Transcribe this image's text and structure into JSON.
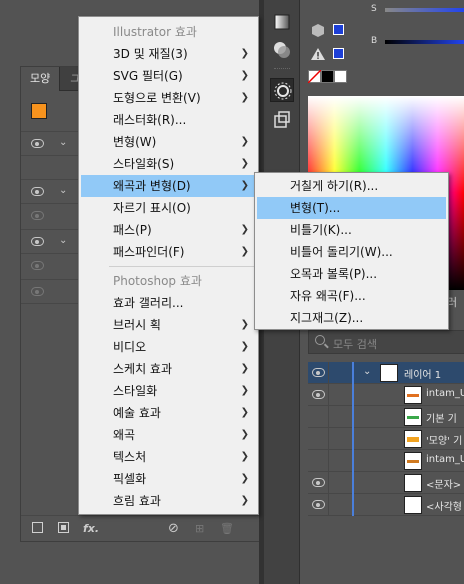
{
  "appearance_panel": {
    "tabs": [
      "모양",
      "ユ"
    ],
    "swatch_color": "#f7931e"
  },
  "main_menu": {
    "items": [
      {
        "label": "Illustrator 효과",
        "type": "header"
      },
      {
        "label": "3D 및 재질(3)",
        "submenu": true
      },
      {
        "label": "SVG 필터(G)",
        "submenu": true
      },
      {
        "label": "도형으로 변환(V)",
        "submenu": true
      },
      {
        "label": "래스터화(R)...",
        "submenu": false
      },
      {
        "label": "변형(W)",
        "submenu": true
      },
      {
        "label": "스타일화(S)",
        "submenu": true
      },
      {
        "label": "왜곡과 변형(D)",
        "submenu": true,
        "highlighted": true
      },
      {
        "label": "자르기 표시(O)",
        "submenu": false
      },
      {
        "label": "패스(P)",
        "submenu": true
      },
      {
        "label": "패스파인더(F)",
        "submenu": true
      },
      {
        "label": "Photoshop 효과",
        "type": "header"
      },
      {
        "label": "효과 갤러리...",
        "submenu": false
      },
      {
        "label": "브러시 획",
        "submenu": true
      },
      {
        "label": "비디오",
        "submenu": true
      },
      {
        "label": "스케치 효과",
        "submenu": true
      },
      {
        "label": "스타일화",
        "submenu": true
      },
      {
        "label": "예술 효과",
        "submenu": true
      },
      {
        "label": "왜곡",
        "submenu": true
      },
      {
        "label": "텍스처",
        "submenu": true
      },
      {
        "label": "픽셀화",
        "submenu": true
      },
      {
        "label": "흐림 효과",
        "submenu": true
      }
    ]
  },
  "sub_menu": {
    "items": [
      {
        "label": "거칠게 하기(R)..."
      },
      {
        "label": "변형(T)...",
        "highlighted": true
      },
      {
        "label": "비틀기(K)..."
      },
      {
        "label": "비틀어 돌리기(W)..."
      },
      {
        "label": "오목과 볼록(P)..."
      },
      {
        "label": "자유 왜곡(F)..."
      },
      {
        "label": "지그재그(Z)..."
      }
    ]
  },
  "color_panel": {
    "slider_s": "S",
    "slider_b": "B",
    "colors": {
      "blue_chip": "#1d3fd6",
      "black": "#000000",
      "white": "#ffffff"
    }
  },
  "layers_panel": {
    "tab_label": "러",
    "search_placeholder": "모두 검색",
    "layers": [
      {
        "name": "레이어 1",
        "visible": true,
        "top": true
      },
      {
        "name": "intam_U",
        "visible": true
      },
      {
        "name": "기본 기",
        "visible": false
      },
      {
        "name": "'모양' 기",
        "visible": false
      },
      {
        "name": "intam_U",
        "visible": false
      },
      {
        "name": "<문자>",
        "visible": true
      },
      {
        "name": "<사각형",
        "visible": true
      }
    ]
  },
  "icons": {
    "fx": "fx."
  }
}
